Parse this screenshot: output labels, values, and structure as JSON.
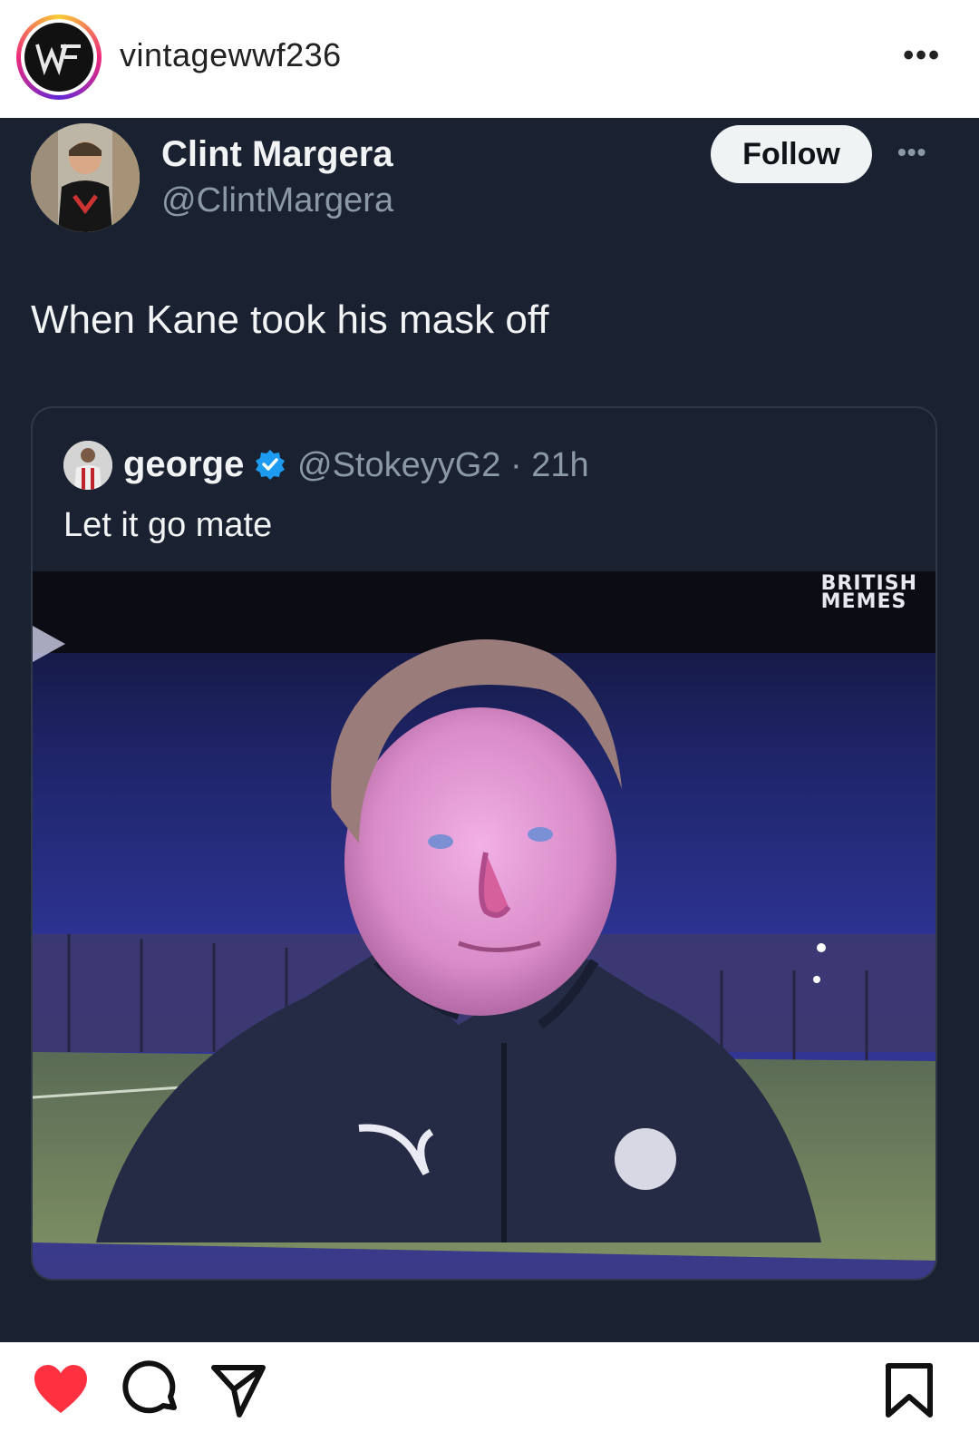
{
  "instagram": {
    "username": "vintagewwf236",
    "avatar_logo": "WF",
    "more_icon": "more-dots-icon"
  },
  "tweet": {
    "display_name": "Clint Margera",
    "handle": "@ClintMargera",
    "follow_label": "Follow",
    "text": "When Kane took his mask off",
    "quoted": {
      "display_name": "george",
      "handle_time": "@StokeyyG2 · 21h",
      "text": "Let it go mate",
      "verified_color": "#1d9bf0",
      "image_watermark_line1": "BRITISH",
      "image_watermark_line2": "MEMES"
    }
  },
  "actions": {
    "like_icon": "heart-icon",
    "like_color": "#ff3040",
    "comment_icon": "comment-icon",
    "share_icon": "send-icon",
    "save_icon": "bookmark-icon"
  }
}
